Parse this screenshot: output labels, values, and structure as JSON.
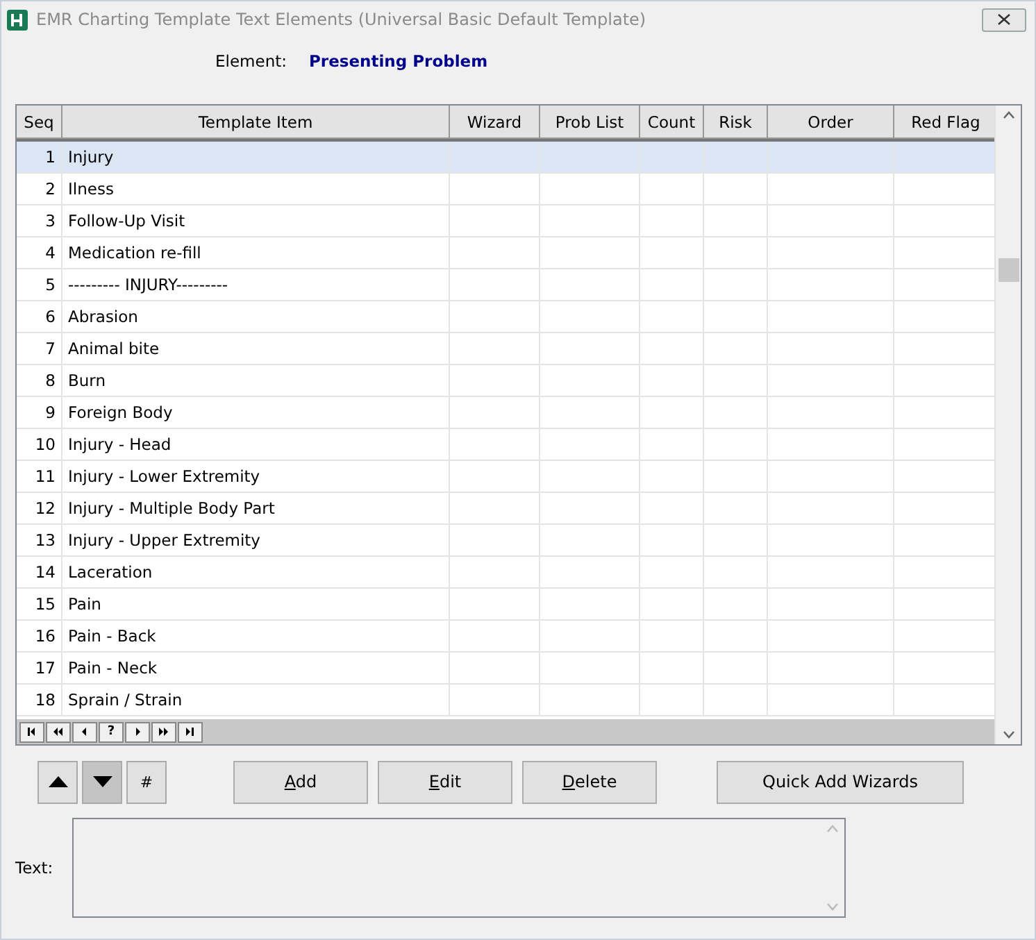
{
  "window": {
    "title": "EMR Charting Template Text Elements (Universal Basic Default Template)"
  },
  "element": {
    "label": "Element:",
    "value": "Presenting Problem"
  },
  "table": {
    "columns": [
      "Seq",
      "Template Item",
      "Wizard",
      "Prob List",
      "Count",
      "Risk",
      "Order",
      "Red Flag"
    ],
    "rows": [
      {
        "seq": "1",
        "item": "Injury",
        "selected": true
      },
      {
        "seq": "2",
        "item": "Ilness",
        "selected": false
      },
      {
        "seq": "3",
        "item": "Follow-Up Visit",
        "selected": false
      },
      {
        "seq": "4",
        "item": "Medication re-fill",
        "selected": false
      },
      {
        "seq": "5",
        "item": "--------- INJURY---------",
        "selected": false
      },
      {
        "seq": "6",
        "item": "Abrasion",
        "selected": false
      },
      {
        "seq": "7",
        "item": "Animal bite",
        "selected": false
      },
      {
        "seq": "8",
        "item": "Burn",
        "selected": false
      },
      {
        "seq": "9",
        "item": "Foreign Body",
        "selected": false
      },
      {
        "seq": "10",
        "item": "Injury - Head",
        "selected": false
      },
      {
        "seq": "11",
        "item": "Injury - Lower Extremity",
        "selected": false
      },
      {
        "seq": "12",
        "item": "Injury - Multiple Body Part",
        "selected": false
      },
      {
        "seq": "13",
        "item": "Injury - Upper Extremity",
        "selected": false
      },
      {
        "seq": "14",
        "item": "Laceration",
        "selected": false
      },
      {
        "seq": "15",
        "item": "Pain",
        "selected": false
      },
      {
        "seq": "16",
        "item": "Pain - Back",
        "selected": false
      },
      {
        "seq": "17",
        "item": "Pain - Neck",
        "selected": false
      },
      {
        "seq": "18",
        "item": "Sprain / Strain",
        "selected": false
      }
    ],
    "navigator": [
      {
        "kind": "first"
      },
      {
        "kind": "prev-page"
      },
      {
        "kind": "prev"
      },
      {
        "kind": "text",
        "label": "?"
      },
      {
        "kind": "next"
      },
      {
        "kind": "next-page"
      },
      {
        "kind": "last"
      }
    ]
  },
  "move_buttons": [
    {
      "kind": "up",
      "selected": false
    },
    {
      "kind": "down",
      "selected": true
    },
    {
      "kind": "text",
      "label": "#",
      "selected": false
    }
  ],
  "buttons": [
    "Add",
    "Edit",
    "Delete"
  ],
  "quick_button": "Quick Add Wizards",
  "text_field": {
    "label": "Text:"
  }
}
